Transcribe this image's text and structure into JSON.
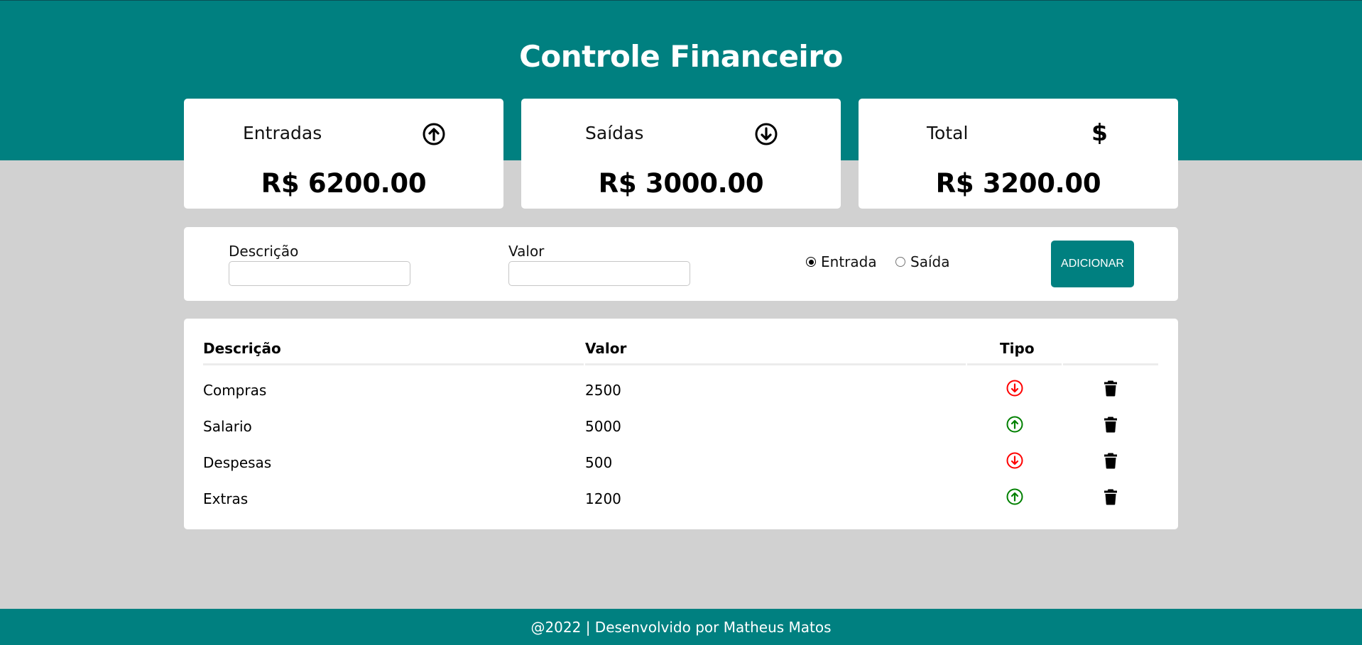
{
  "header": {
    "title": "Controle Financeiro"
  },
  "cards": [
    {
      "label": "Entradas",
      "icon": "arrow-up-circle-icon",
      "value": "R$ 6200.00"
    },
    {
      "label": "Saídas",
      "icon": "arrow-down-circle-icon",
      "value": "R$ 3000.00"
    },
    {
      "label": "Total",
      "icon": "dollar-icon",
      "symbol": "$",
      "value": "R$ 3200.00"
    }
  ],
  "form": {
    "description_label": "Descrição",
    "description_value": "",
    "value_label": "Valor",
    "value_value": "",
    "radio_income_label": "Entrada",
    "radio_expense_label": "Saída",
    "selected_type": "Entrada",
    "add_button_label": "ADICIONAR"
  },
  "table": {
    "headers": [
      "Descrição",
      "Valor",
      "Tipo",
      ""
    ],
    "rows": [
      {
        "description": "Compras",
        "value": "2500",
        "type": "expense"
      },
      {
        "description": "Salario",
        "value": "5000",
        "type": "income"
      },
      {
        "description": "Despesas",
        "value": "500",
        "type": "expense"
      },
      {
        "description": "Extras",
        "value": "1200",
        "type": "income"
      }
    ]
  },
  "colors": {
    "primary": "#008080",
    "background": "#d1d1d1",
    "income": "#008000",
    "expense": "#ff0000"
  },
  "footer": {
    "text": "@2022 | Desenvolvido por Matheus Matos"
  }
}
